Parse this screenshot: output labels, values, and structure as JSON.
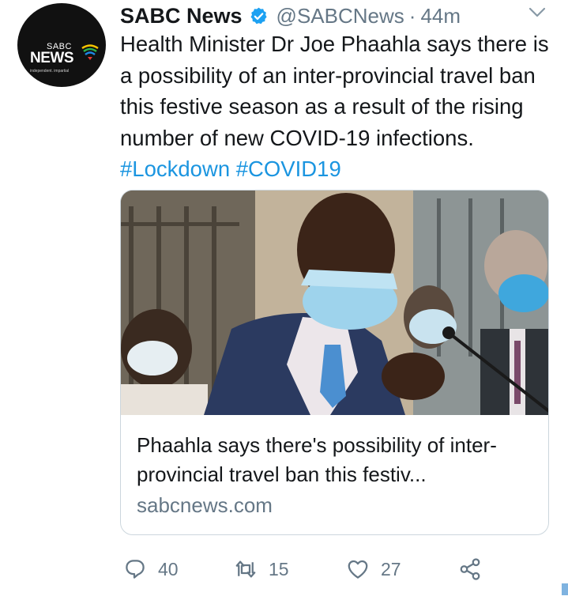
{
  "tweet": {
    "author": {
      "name": "SABC News",
      "handle": "@SABCNews",
      "separator": "·",
      "time": "44m",
      "avatar_logo": {
        "top": "SABC",
        "main": "NEWS",
        "tagline": "independent. impartial"
      }
    },
    "text_main": "Health Minister Dr Joe Phaahla says there is a possibility of an inter-provincial travel ban this festive season as a result of the rising number of new COVID-19 infections.",
    "hashtags": [
      "#Lockdown",
      "#COVID19"
    ],
    "card": {
      "title": "Phaahla says there's possibility of inter-provincial travel ban this festiv...",
      "domain": "sabcnews.com"
    },
    "actions": {
      "reply_count": "40",
      "retweet_count": "15",
      "like_count": "27"
    }
  },
  "colors": {
    "text": "#14171a",
    "secondary": "#657786",
    "link": "#1b95e0",
    "verified": "#1da1f2",
    "border": "#ccd6dd"
  },
  "icons": {
    "verified": "verified-badge-icon",
    "menu": "chevron-down-icon",
    "reply": "reply-icon",
    "retweet": "retweet-icon",
    "like": "heart-icon",
    "share": "share-icon"
  }
}
